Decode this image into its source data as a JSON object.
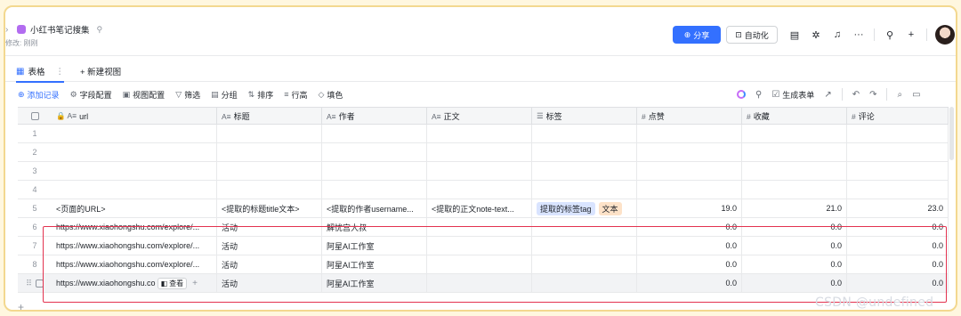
{
  "header": {
    "title": "小红书笔记搜集",
    "subtitle": "修改: 刚刚",
    "share_label": "分享",
    "automation_label": "自动化"
  },
  "tabs": {
    "active_label": "表格",
    "new_view_label": "+ 新建视图"
  },
  "toolbar": {
    "add_record": "添加记录",
    "field_config": "字段配置",
    "view_config": "视图配置",
    "filter": "筛选",
    "group": "分组",
    "sort": "排序",
    "row_height": "行高",
    "fill_color": "填色",
    "generate_form": "生成表单"
  },
  "columns": [
    {
      "type_icon": "🔒 A≡",
      "label": "url"
    },
    {
      "type_icon": "A≡",
      "label": "标题"
    },
    {
      "type_icon": "A≡",
      "label": "作者"
    },
    {
      "type_icon": "A≡",
      "label": "正文"
    },
    {
      "type_icon": "☰",
      "label": "标签"
    },
    {
      "type_icon": "#",
      "label": "点赞"
    },
    {
      "type_icon": "#",
      "label": "收藏"
    },
    {
      "type_icon": "#",
      "label": "评论"
    }
  ],
  "rows": [
    {
      "n": "1",
      "url": "",
      "title": "",
      "author": "",
      "body": "",
      "tags": [],
      "likes": "",
      "fav": "",
      "comments": ""
    },
    {
      "n": "2",
      "url": "",
      "title": "",
      "author": "",
      "body": "",
      "tags": [],
      "likes": "",
      "fav": "",
      "comments": ""
    },
    {
      "n": "3",
      "url": "",
      "title": "",
      "author": "",
      "body": "",
      "tags": [],
      "likes": "",
      "fav": "",
      "comments": ""
    },
    {
      "n": "4",
      "url": "",
      "title": "",
      "author": "",
      "body": "",
      "tags": [],
      "likes": "",
      "fav": "",
      "comments": ""
    },
    {
      "n": "5",
      "url": "<页面的URL>",
      "title": "<提取的标题title文本>",
      "author": "<提取的作者username...",
      "body": "<提取的正文note-text...",
      "tags": [
        "提取的标签tag",
        "文本"
      ],
      "likes": "19.0",
      "fav": "21.0",
      "comments": "23.0"
    },
    {
      "n": "6",
      "url": "https://www.xiaohongshu.com/explore/...",
      "title": "活动",
      "author": "解忧宫大叔",
      "body": "",
      "tags": [],
      "likes": "0.0",
      "fav": "0.0",
      "comments": "0.0"
    },
    {
      "n": "7",
      "url": "https://www.xiaohongshu.com/explore/...",
      "title": "活动",
      "author": "阿星AI工作室",
      "body": "",
      "tags": [],
      "likes": "0.0",
      "fav": "0.0",
      "comments": "0.0"
    },
    {
      "n": "8",
      "url": "https://www.xiaohongshu.com/explore/...",
      "title": "活动",
      "author": "阿星AI工作室",
      "body": "",
      "tags": [],
      "likes": "0.0",
      "fav": "0.0",
      "comments": "0.0"
    },
    {
      "n": "",
      "url": "https://www.xiaohongshu.co",
      "title": "活动",
      "author": "阿星AI工作室",
      "body": "",
      "tags": [],
      "likes": "0.0",
      "fav": "0.0",
      "comments": "0.0"
    }
  ],
  "row9_view_button": "查看",
  "watermark": "CSDN @undefined",
  "colors": {
    "accent": "#3370ff",
    "highlight": "#e3324f",
    "tag_blue": "#d9e4ff",
    "tag_orange": "#fde2c8"
  }
}
